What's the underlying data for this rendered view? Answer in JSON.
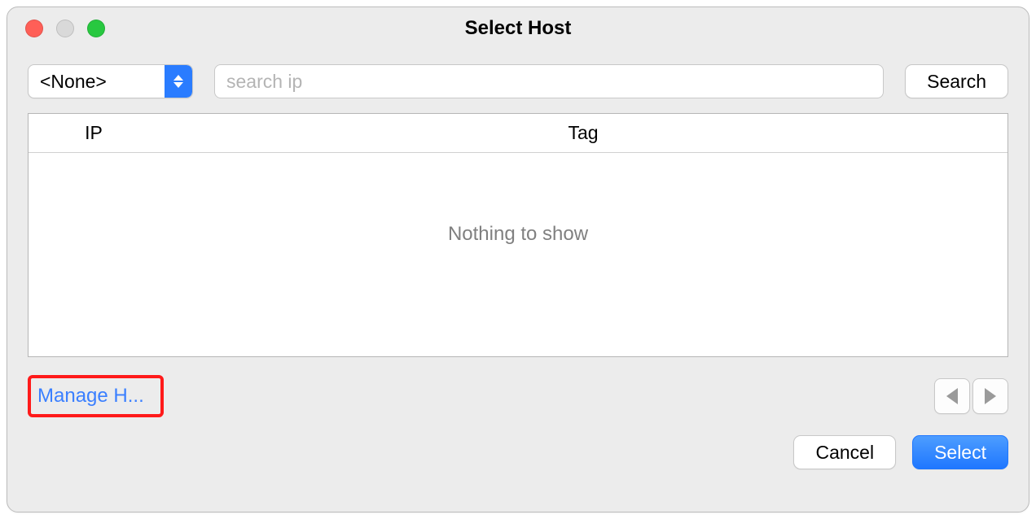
{
  "window": {
    "title": "Select Host"
  },
  "toolbar": {
    "filter_selected": "<None>",
    "search_placeholder": "search ip",
    "search_value": "",
    "search_button": "Search"
  },
  "table": {
    "columns": {
      "ip": "IP",
      "tag": "Tag"
    },
    "rows": [],
    "empty_message": "Nothing to show"
  },
  "footer": {
    "manage_link": "Manage H...",
    "cancel": "Cancel",
    "select": "Select"
  }
}
